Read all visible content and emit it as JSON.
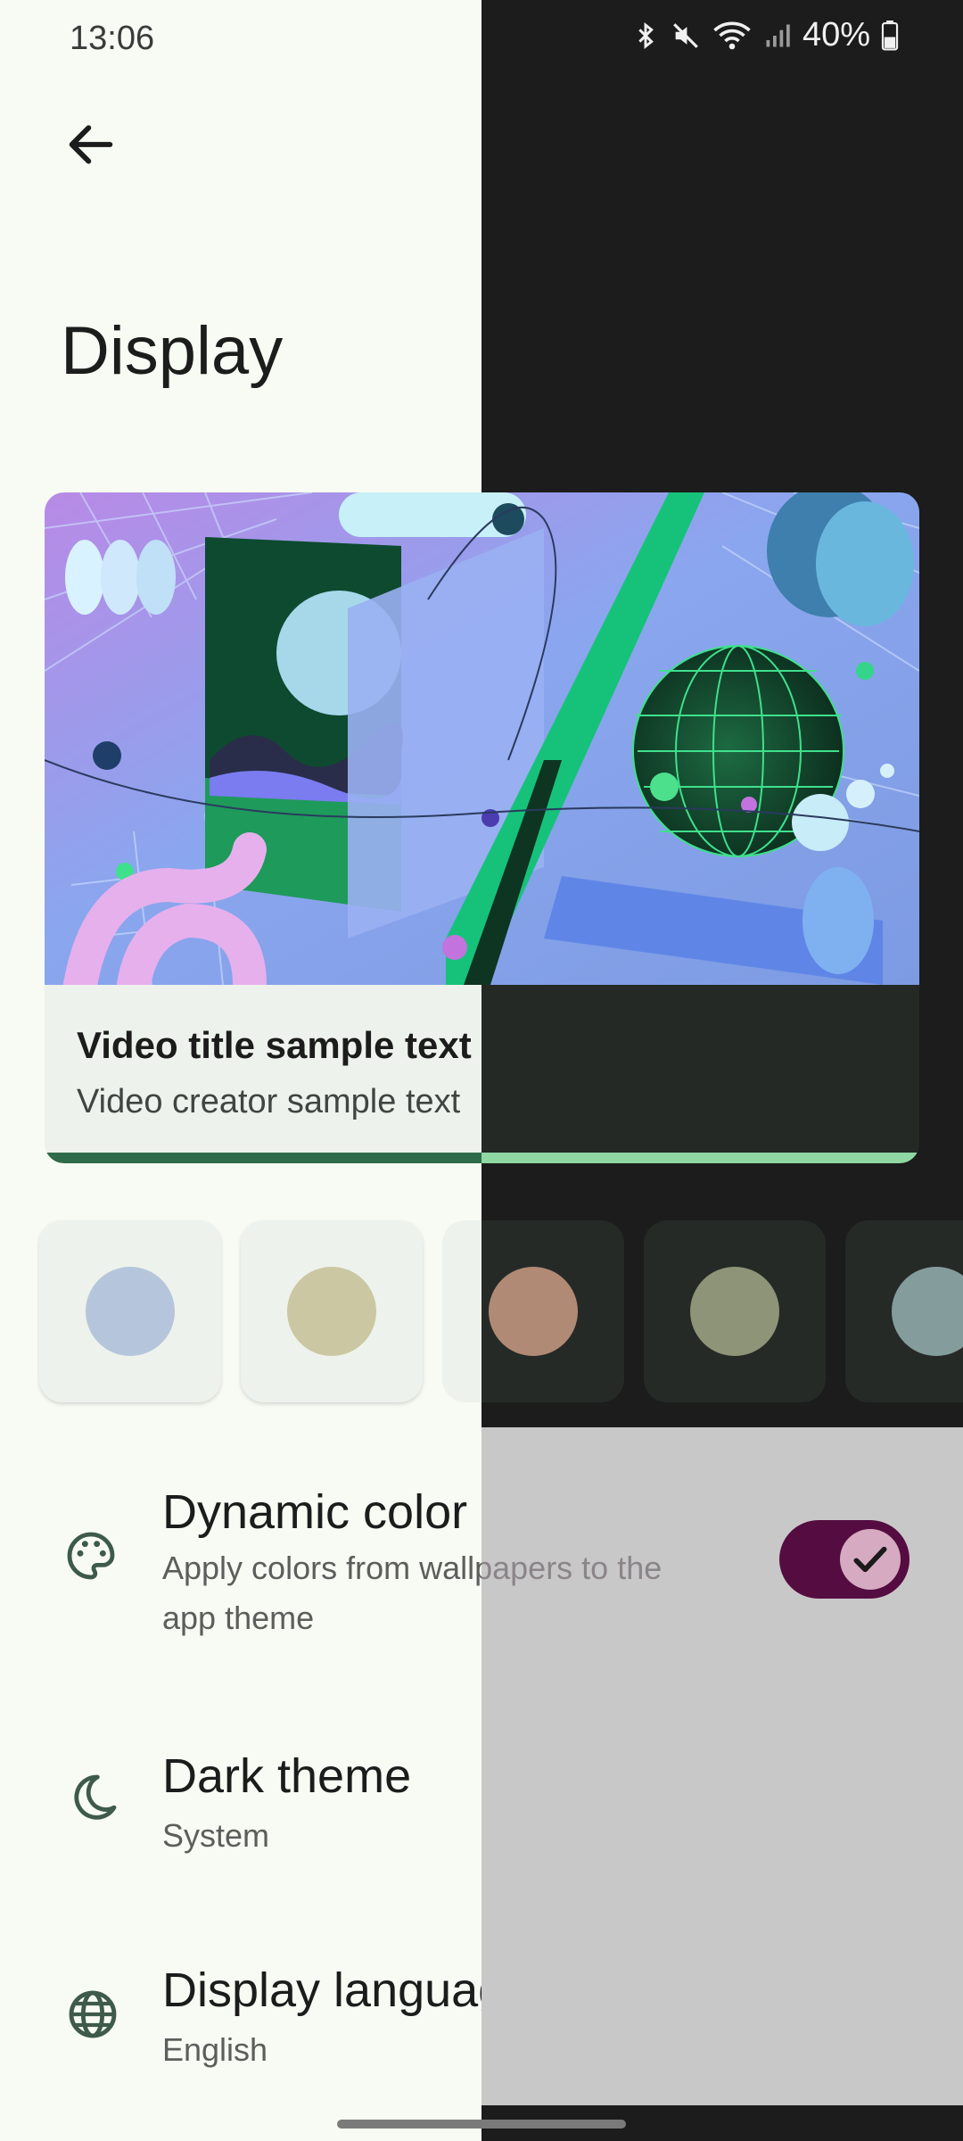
{
  "status_bar": {
    "time": "13:06",
    "battery": "40%"
  },
  "page": {
    "title": "Display"
  },
  "preview": {
    "video_title": "Video title sample text",
    "video_creator": "Video creator sample text"
  },
  "swatches": [
    {
      "color": "#b5c6dc"
    },
    {
      "color": "#cbc7a2"
    },
    {
      "color": "#b08a74"
    },
    {
      "color": "#8e9478"
    },
    {
      "color": "#859c9c"
    }
  ],
  "settings": {
    "dynamic_color": {
      "title": "Dynamic color",
      "subtitle_line1": "Apply colors from wallpapers to the",
      "subtitle_line2": "app theme",
      "enabled": true
    },
    "dark_theme": {
      "title": "Dark theme",
      "value": "System"
    },
    "display_language": {
      "title": "Display language",
      "value": "English"
    }
  },
  "colors": {
    "light_bg": "#f7fbf3",
    "dark_bg": "#1b1c1b",
    "accent": "#8fd7a3",
    "icon": "#3e5a4b"
  }
}
